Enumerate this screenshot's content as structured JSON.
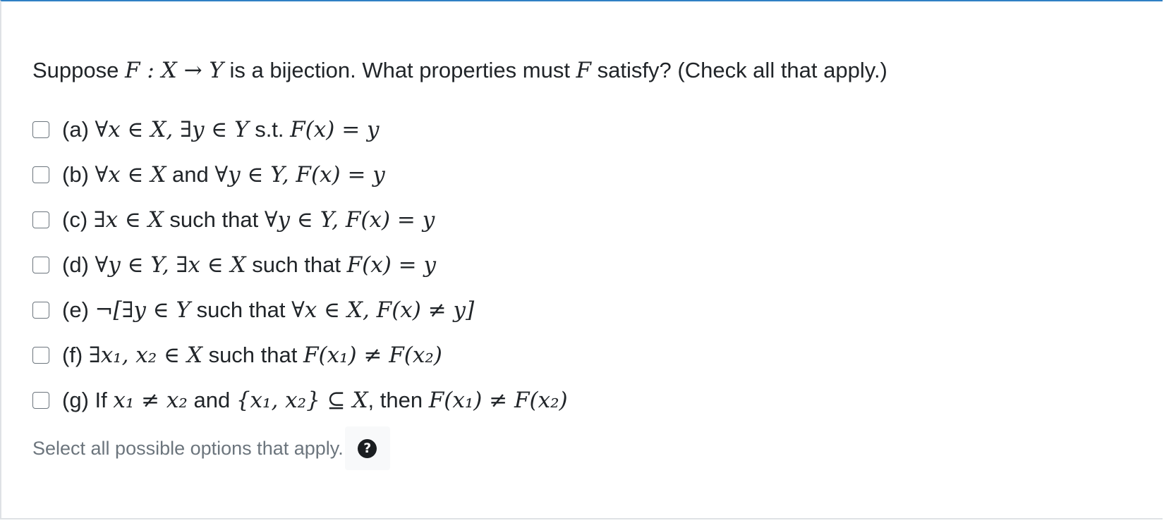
{
  "question": {
    "prefix": "Suppose ",
    "math_1": "F : X → Y",
    "middle": " is a  bijection. What properties must ",
    "math_2": "F",
    "suffix": " satisfy? (Check all that apply.)"
  },
  "options": [
    {
      "label": "(a) ",
      "math_1": "∀x ∈ X, ∃y ∈ Y",
      "text_1": " s.t. ",
      "math_2": "F(x) = y"
    },
    {
      "label": "(b) ",
      "math_1": "∀x ∈ X",
      "text_1": " and ",
      "math_2": "∀y ∈ Y, F(x) = y"
    },
    {
      "label": "(c) ",
      "math_1": "∃x ∈ X",
      "text_1": " such that ",
      "math_2": "∀y ∈ Y, F(x) = y"
    },
    {
      "label": "(d) ",
      "math_1": "∀y ∈ Y, ∃x ∈ X",
      "text_1": "  such that ",
      "math_2": "F(x) = y"
    },
    {
      "label": "(e) ",
      "math_1": "¬[∃y ∈ Y",
      "text_1": " such that ",
      "math_2": "∀x ∈ X, F(x) ≠ y]"
    },
    {
      "label": "(f)  ",
      "math_1": "∃x₁, x₂ ∈ X",
      "text_1": " such that ",
      "math_2": "F(x₁) ≠ F(x₂)"
    },
    {
      "label": "(g) If ",
      "math_1": "x₁ ≠ x₂",
      "text_1": " and ",
      "math_2": "{x₁, x₂} ⊆ X",
      "text_2": ", then ",
      "math_3": "F(x₁) ≠ F(x₂)"
    }
  ],
  "hint": {
    "text": "Select all possible options that apply.",
    "help_icon": "?"
  }
}
